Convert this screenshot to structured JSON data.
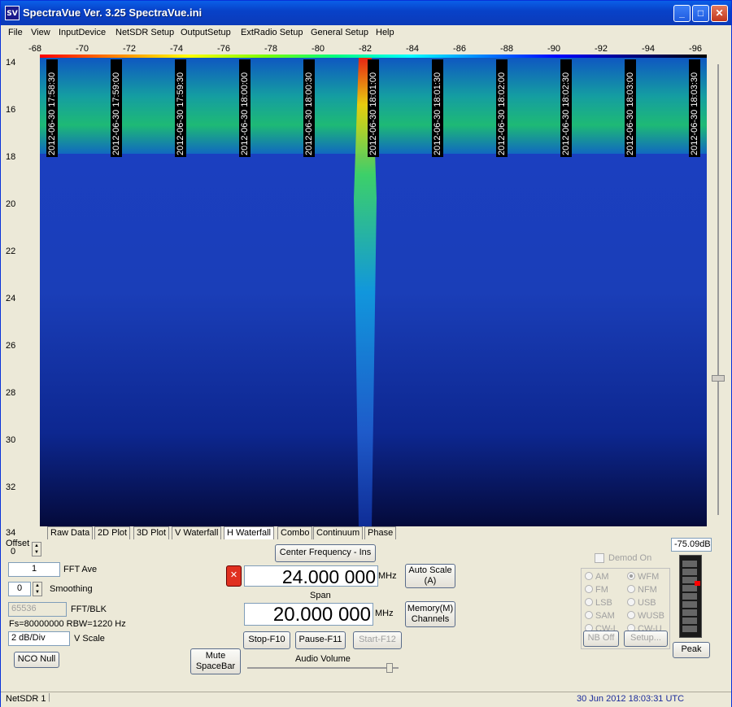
{
  "window": {
    "title": "SpectraVue Ver. 3.25  SpectraVue.ini",
    "icon_text": "SV",
    "controls": {
      "minimize": "_",
      "maximize": "□",
      "close": "✕"
    }
  },
  "menu": [
    "File",
    "View",
    "InputDevice",
    "NetSDR Setup",
    "OutputSetup",
    "ExtRadio Setup",
    "General Setup",
    "Help"
  ],
  "top_axis": [
    "-68",
    "-70",
    "-72",
    "-74",
    "-76",
    "-78",
    "-80",
    "-82",
    "-84",
    "-86",
    "-88",
    "-90",
    "-92",
    "-94",
    "-96"
  ],
  "left_axis": [
    "14",
    "16",
    "18",
    "20",
    "22",
    "24",
    "26",
    "28",
    "30",
    "32",
    "34"
  ],
  "timestamps": [
    "2012-06-30 17:58:30",
    "2012-06-30 17:59:00",
    "2012-06-30 17:59:30",
    "2012-06-30 18:00:00",
    "2012-06-30 18:00:30",
    "2012-06-30 18:01:00",
    "2012-06-30 18:01:30",
    "2012-06-30 18:02:00",
    "2012-06-30 18:02:30",
    "2012-06-30 18:03:00",
    "2012-06-30 18:03:30"
  ],
  "tabs": [
    "Raw Data",
    "2D Plot",
    "3D Plot",
    "V Waterfall",
    "H Waterfall",
    "Combo",
    "Continuum",
    "Phase"
  ],
  "active_tab": "H Waterfall",
  "controls": {
    "offset_label": "Offset",
    "offset_value": "0",
    "fft_ave_value": "1",
    "fft_ave_label": "FFT Ave",
    "smoothing_value": "0",
    "smoothing_label": "Smoothing",
    "fft_blk_value": "65536",
    "fft_blk_label": "FFT/BLK",
    "fs_info": "Fs=80000000 RBW=1220 Hz",
    "vscale_value": "2 dB/Div",
    "vscale_label": "V Scale",
    "nco_null": "NCO Null",
    "center_freq_button": "Center Frequency - Ins",
    "center_freq_value": "24.000 000",
    "center_freq_unit": "MHz",
    "auto_scale": "Auto Scale (A)",
    "span_label": "Span",
    "span_value": "20.000 000",
    "span_unit": "MHz",
    "memory_channels": "Memory(M) Channels",
    "stop": "Stop-F10",
    "pause": "Pause-F11",
    "start": "Start-F12",
    "mute": "Mute SpaceBar",
    "audio_volume": "Audio Volume",
    "x_button": "✕"
  },
  "demod": {
    "label": "Demod On",
    "modes_left": [
      "AM",
      "FM",
      "LSB",
      "SAM",
      "CW-L"
    ],
    "modes_right": [
      "WFM",
      "NFM",
      "USB",
      "WUSB",
      "CW-U"
    ],
    "selected": "WFM",
    "nb_off": "NB Off",
    "setup": "Setup..."
  },
  "meter": {
    "readout": "-75.09dB",
    "peak_button": "Peak"
  },
  "status": {
    "device": "NetSDR 1",
    "datetime": "30 Jun 2012  18:03:31 UTC"
  }
}
